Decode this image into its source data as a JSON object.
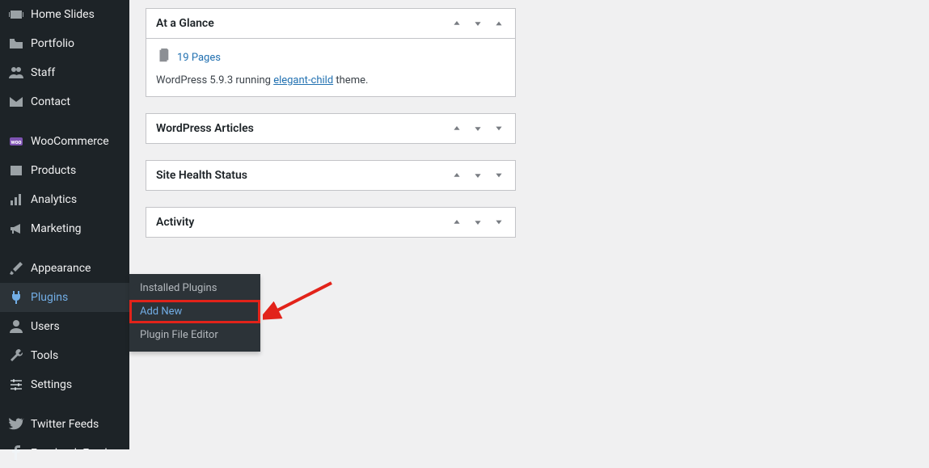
{
  "sidebar": {
    "items": [
      {
        "id": "home-slides",
        "label": "Home Slides"
      },
      {
        "id": "portfolio",
        "label": "Portfolio"
      },
      {
        "id": "staff",
        "label": "Staff"
      },
      {
        "id": "contact",
        "label": "Contact"
      },
      {
        "id": "woocommerce",
        "label": "WooCommerce"
      },
      {
        "id": "products",
        "label": "Products"
      },
      {
        "id": "analytics",
        "label": "Analytics"
      },
      {
        "id": "marketing",
        "label": "Marketing"
      },
      {
        "id": "appearance",
        "label": "Appearance"
      },
      {
        "id": "plugins",
        "label": "Plugins"
      },
      {
        "id": "users",
        "label": "Users"
      },
      {
        "id": "tools",
        "label": "Tools"
      },
      {
        "id": "settings",
        "label": "Settings"
      },
      {
        "id": "twitter-feeds",
        "label": "Twitter Feeds"
      },
      {
        "id": "facebook-feed",
        "label": "Facebook Feed"
      }
    ]
  },
  "submenu": {
    "items": [
      {
        "label": "Installed Plugins"
      },
      {
        "label": "Add New"
      },
      {
        "label": "Plugin File Editor"
      }
    ]
  },
  "panels": {
    "glance": {
      "title": "At a Glance",
      "pages_link": "19 Pages",
      "wp_prefix": "WordPress 5.9.3 running ",
      "theme_link": "elegant-child",
      "wp_suffix": " theme."
    },
    "articles": {
      "title": "WordPress Articles"
    },
    "health": {
      "title": "Site Health Status"
    },
    "activity": {
      "title": "Activity"
    }
  }
}
